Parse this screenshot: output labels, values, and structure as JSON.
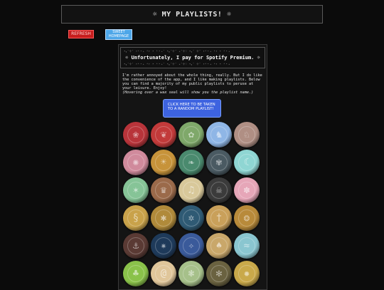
{
  "header": {
    "title": "☼ MY PLAYLISTS! ☼"
  },
  "buttons": {
    "refresh_label": "REFRESH",
    "home_label": "SWEET HOMEPAGE"
  },
  "panel": {
    "sparkle_line": "⋆｡˚⊹˚ ˖⁺‧₊ ⁺˖ ⋆ ⁺‧₊˚ ⋆｡˚⊹˚ ₊˚⊹♡ ⋆｡˚ ⊹˚ ˖⁺‧₊ ⁺˖ ⋆ ⁺‧₊",
    "quote": "☼ Unfortunately, I pay for Spotify Premium. ☼",
    "intro": "I'm rather annoyed about the whole thing, really. But I do like the convenience of the app, and I like making playlists. Below you can find a majority of my public playlists to peruse at your leisure. Enjoy!",
    "hint": "(Hovering over a wax seal will show you the playlist name.)",
    "random_button": "CLICK HERE TO BE TAKEN TO A RANDOM PLAYLIST!"
  },
  "seals": [
    {
      "color": "#b8343a",
      "icon": "rose-icon"
    },
    {
      "color": "#c23a3a",
      "icon": "leaf-icon"
    },
    {
      "color": "#7fa86a",
      "icon": "fern-icon"
    },
    {
      "color": "#8fb6e6",
      "icon": "stag-icon"
    },
    {
      "color": "#b08f84",
      "icon": "fox-icon"
    },
    {
      "color": "#d08a9c",
      "icon": "crab-icon"
    },
    {
      "color": "#c7933a",
      "icon": "sun-icon"
    },
    {
      "color": "#4a8a6e",
      "icon": "monstera-icon"
    },
    {
      "color": "#4a5a62",
      "icon": "wreath-icon"
    },
    {
      "color": "#8fd6d3",
      "icon": "moon-icon"
    },
    {
      "color": "#86c497",
      "icon": "shell-icon"
    },
    {
      "color": "#9b6a4a",
      "icon": "lion-icon"
    },
    {
      "color": "#d8c89a",
      "icon": "music-note-icon"
    },
    {
      "color": "#3b3b3b",
      "icon": "skull-icon"
    },
    {
      "color": "#e6a6b8",
      "icon": "flower-icon"
    },
    {
      "color": "#c9a24a",
      "icon": "serpent-icon"
    },
    {
      "color": "#b08a3a",
      "icon": "bee-icon"
    },
    {
      "color": "#2f5a74",
      "icon": "branch-icon"
    },
    {
      "color": "#c9a05a",
      "icon": "sword-icon"
    },
    {
      "color": "#b88a3a",
      "icon": "dragon-icon"
    },
    {
      "color": "#5a3a34",
      "icon": "ship-icon"
    },
    {
      "color": "#1e3a5a",
      "icon": "galaxy-icon"
    },
    {
      "color": "#3a5a9a",
      "icon": "compass-icon"
    },
    {
      "color": "#c9a76a",
      "icon": "mushroom-icon"
    },
    {
      "color": "#8ac6d0",
      "icon": "wave-icon"
    },
    {
      "color": "#8ac24a",
      "icon": "clover-icon"
    },
    {
      "color": "#e0c69a",
      "icon": "swirl-icon"
    },
    {
      "color": "#a6c08a",
      "icon": "laurel-icon"
    },
    {
      "color": "#6a6240",
      "icon": "bug-icon"
    },
    {
      "color": "#c9a94a",
      "icon": "wheel-icon"
    }
  ]
}
